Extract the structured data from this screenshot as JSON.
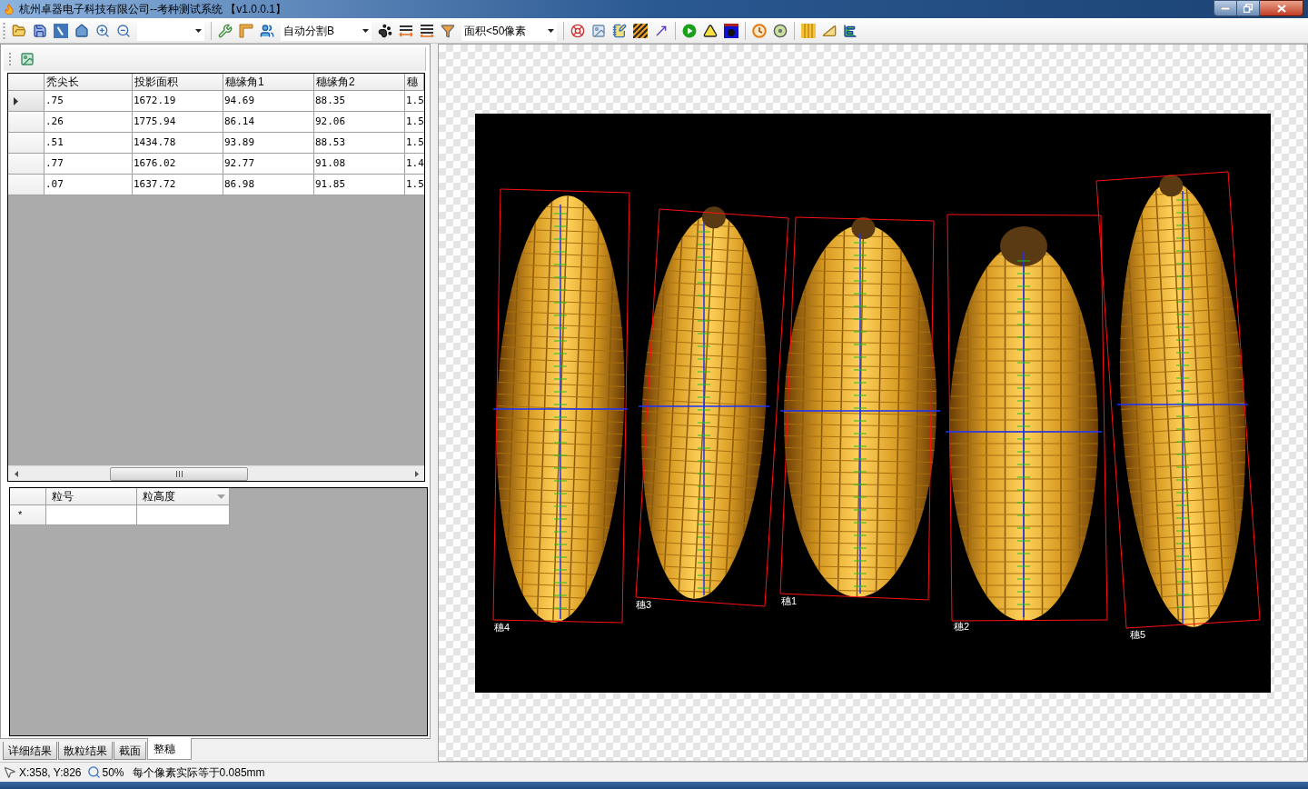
{
  "window": {
    "title": "杭州卓器电子科技有限公司--考种测试系统 【v1.0.0.1】"
  },
  "toolbar": {
    "segmentation_combo": {
      "value": "自动分割B"
    },
    "area_filter_combo": {
      "value": "面积<50像素"
    }
  },
  "results_table": {
    "columns": [
      "秃尖长",
      "投影面积",
      "穗缘角1",
      "穗缘角2",
      "穗"
    ],
    "rows": [
      {
        "selected": true,
        "cells": [
          ".75",
          "1672.19",
          "94.69",
          "88.35",
          "1.5"
        ]
      },
      {
        "selected": false,
        "cells": [
          ".26",
          "1775.94",
          "86.14",
          "92.06",
          "1.5"
        ]
      },
      {
        "selected": false,
        "cells": [
          ".51",
          "1434.78",
          "93.89",
          "88.53",
          "1.5"
        ]
      },
      {
        "selected": false,
        "cells": [
          ".77",
          "1676.02",
          "92.77",
          "91.08",
          "1.4"
        ]
      },
      {
        "selected": false,
        "cells": [
          ".07",
          "1637.72",
          "86.98",
          "91.85",
          "1.5"
        ]
      }
    ]
  },
  "grain_table": {
    "columns": [
      "粒号",
      "粒高度"
    ],
    "new_row_marker": "*"
  },
  "tabs": [
    {
      "label": "详细结果",
      "selected": false
    },
    {
      "label": "散粒结果",
      "selected": false
    },
    {
      "label": "截面",
      "selected": false
    },
    {
      "label": "整穗",
      "selected": true
    }
  ],
  "image": {
    "ears": [
      {
        "label": "穗4"
      },
      {
        "label": "穗3"
      },
      {
        "label": "穗1"
      },
      {
        "label": "穗2"
      },
      {
        "label": "穗5"
      }
    ]
  },
  "status_bar": {
    "coordinates": "X:358, Y:826",
    "zoom": "50%",
    "scale": "每个像素实际等于0.085mm"
  }
}
